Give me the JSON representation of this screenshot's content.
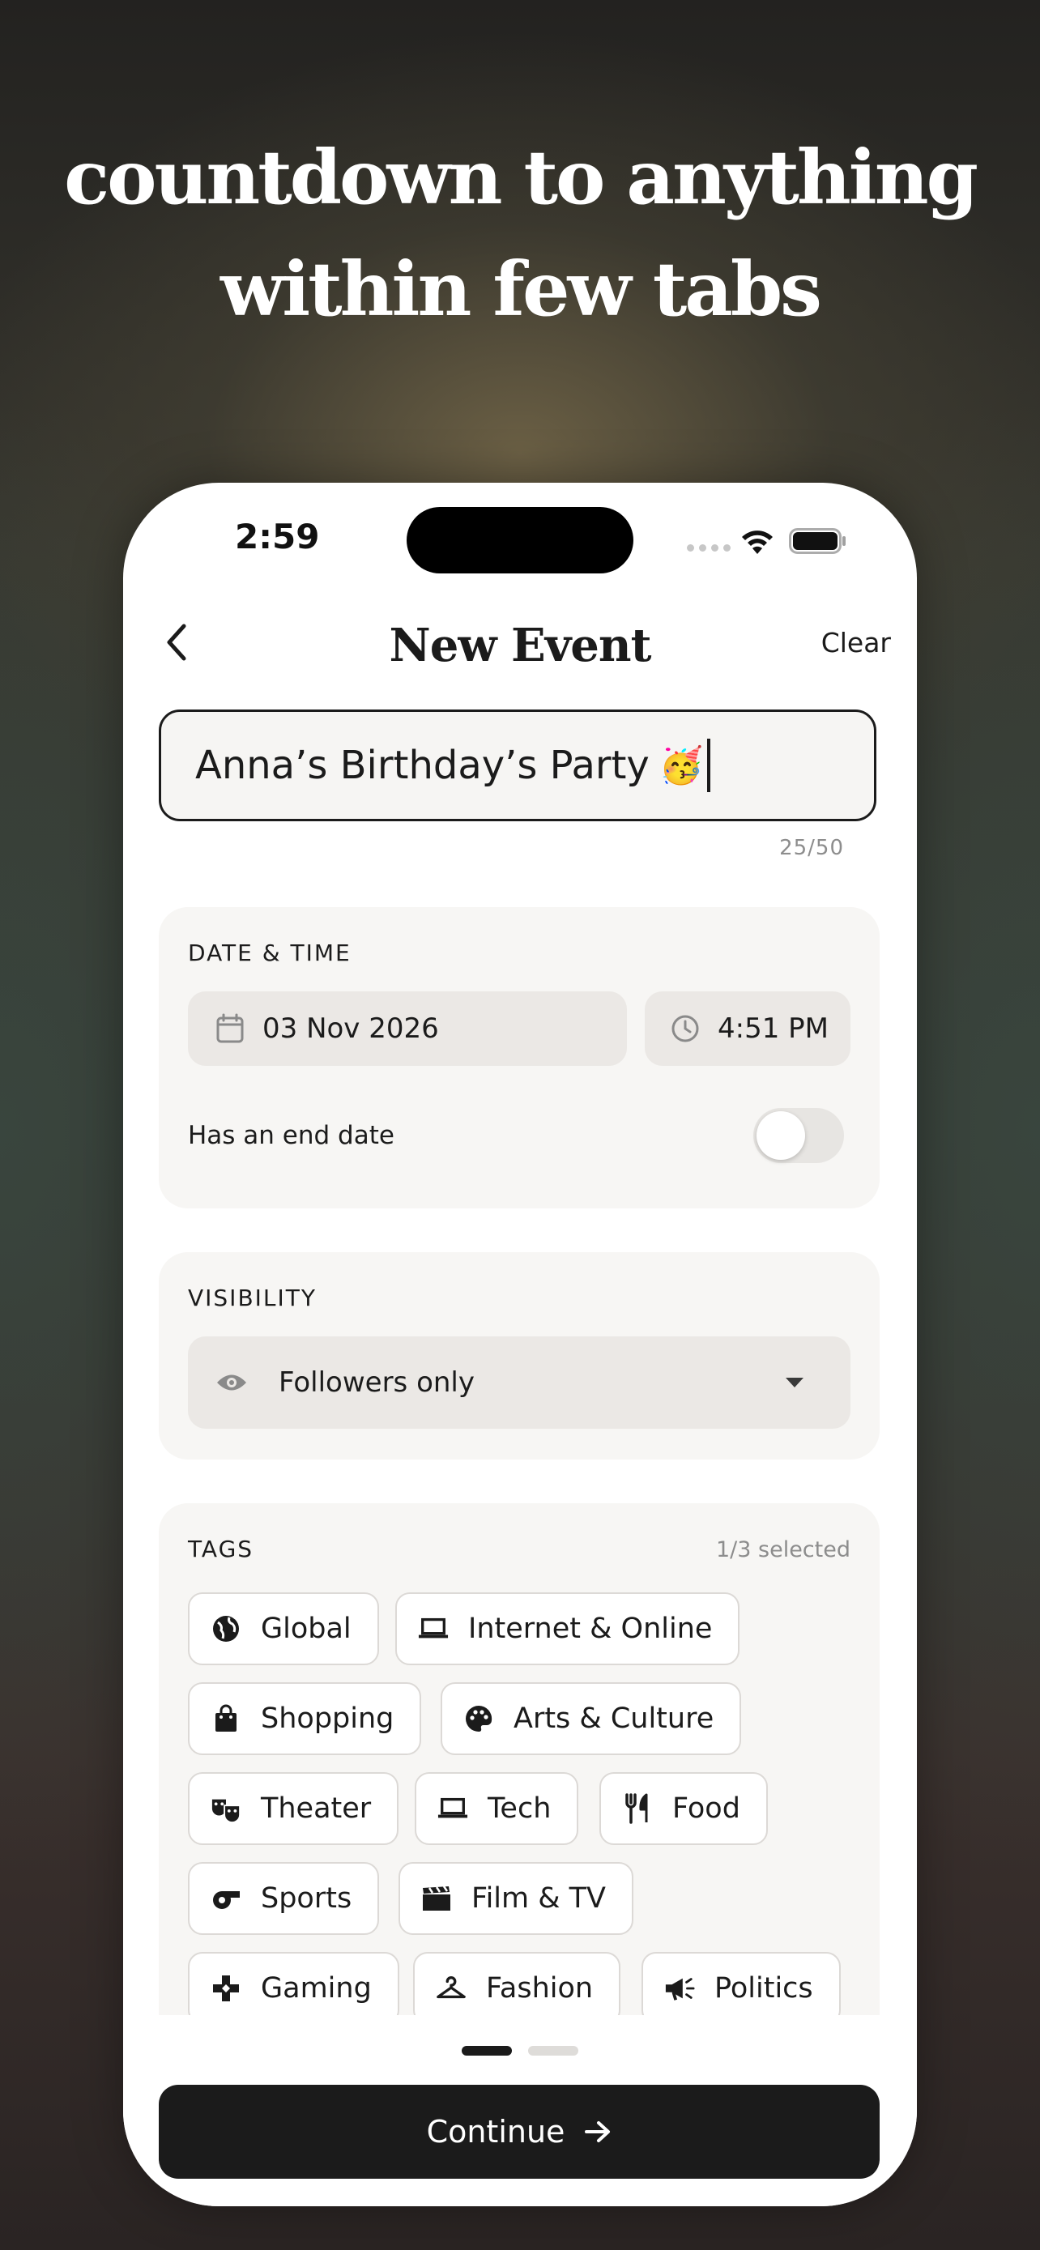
{
  "headline": {
    "line1": "countdown to anything",
    "line2": "within few tabs"
  },
  "status_bar": {
    "time": "2:59"
  },
  "nav": {
    "title": "New Event",
    "clear_label": "Clear",
    "back_icon": "chevron-left-icon"
  },
  "event_name": {
    "value": "Anna’s Birthday’s Party",
    "emoji": "🥳",
    "counter": "25/50"
  },
  "date_time": {
    "label": "DATE & TIME",
    "date": "03 Nov 2026",
    "time": "4:51 PM",
    "end_date_label": "Has an end date",
    "end_date_enabled": false
  },
  "visibility": {
    "label": "VISIBILITY",
    "selected": "Followers only"
  },
  "tags": {
    "label": "TAGS",
    "selected_count": "1/3 selected",
    "items": [
      {
        "label": "Global",
        "icon": "globe-icon"
      },
      {
        "label": "Internet & Online",
        "icon": "laptop-icon"
      },
      {
        "label": "Shopping",
        "icon": "shopping-bag-icon"
      },
      {
        "label": "Arts & Culture",
        "icon": "palette-icon"
      },
      {
        "label": "Theater",
        "icon": "theater-masks-icon"
      },
      {
        "label": "Tech",
        "icon": "laptop-icon"
      },
      {
        "label": "Food",
        "icon": "utensils-icon"
      },
      {
        "label": "Sports",
        "icon": "whistle-icon"
      },
      {
        "label": "Film & TV",
        "icon": "clapperboard-icon"
      },
      {
        "label": "Gaming",
        "icon": "gamepad-icon"
      },
      {
        "label": "Fashion",
        "icon": "hanger-icon"
      },
      {
        "label": "Politics",
        "icon": "megaphone-icon"
      }
    ]
  },
  "pager": {
    "pages": 2,
    "current": 1
  },
  "continue_label": "Continue",
  "colors": {
    "primary": "#1b1b1b",
    "card_bg": "#f7f6f4",
    "pill_bg": "#ebe8e5",
    "muted": "#8d8d8d"
  }
}
